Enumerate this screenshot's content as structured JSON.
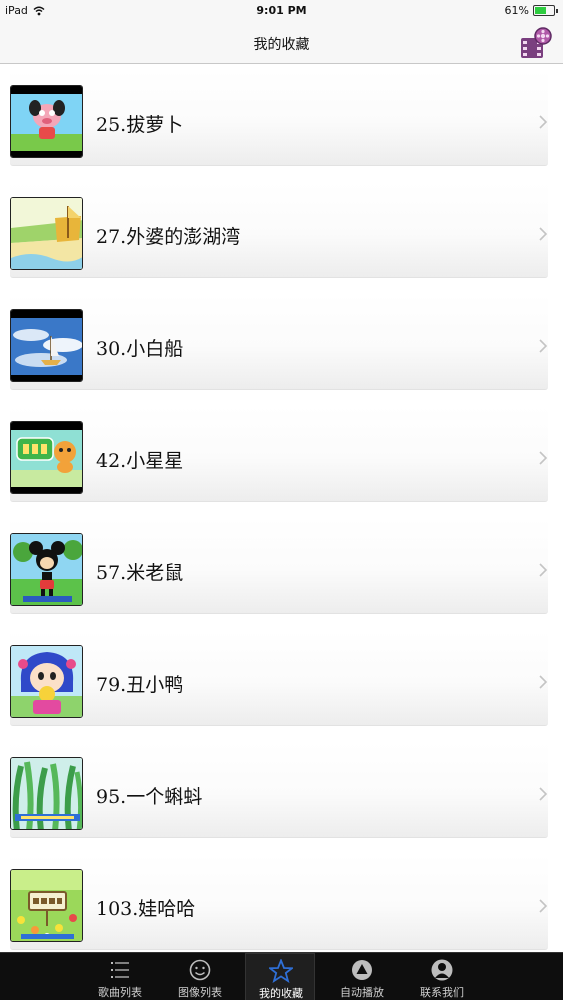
{
  "status_bar": {
    "device": "iPad",
    "time": "9:01 PM",
    "battery": "61%",
    "battery_level": 0.61
  },
  "nav": {
    "title": "我的收藏",
    "right_icon": "film-reel-icon"
  },
  "favorites": [
    {
      "label": "25.拔萝卜",
      "thumb": "cartoon-pig-thumbnail"
    },
    {
      "label": "27.外婆的澎湖湾",
      "thumb": "beach-boat-thumbnail"
    },
    {
      "label": "30.小白船",
      "thumb": "sailboat-sky-thumbnail"
    },
    {
      "label": "42.小星星",
      "thumb": "little-star-title-thumbnail"
    },
    {
      "label": "57.米老鼠",
      "thumb": "mickey-mouse-thumbnail"
    },
    {
      "label": "79.丑小鸭",
      "thumb": "cartoon-girl-thumbnail"
    },
    {
      "label": "95.一个蝌蚪",
      "thumb": "tadpole-reeds-thumbnail"
    },
    {
      "label": "103.娃哈哈",
      "thumb": "flower-meadow-thumbnail"
    }
  ],
  "tabs": [
    {
      "label": "歌曲列表",
      "icon": "list-icon",
      "active": false
    },
    {
      "label": "图像列表",
      "icon": "smiley-icon",
      "active": false
    },
    {
      "label": "我的收藏",
      "icon": "star-icon",
      "active": true
    },
    {
      "label": "自动播放",
      "icon": "play-up-icon",
      "active": false
    },
    {
      "label": "联系我们",
      "icon": "person-icon",
      "active": false
    }
  ],
  "colors": {
    "tab_bar_bg": "#0e0e0e",
    "star_blue": "#2f6fd6",
    "battery_green": "#2ecc40"
  }
}
